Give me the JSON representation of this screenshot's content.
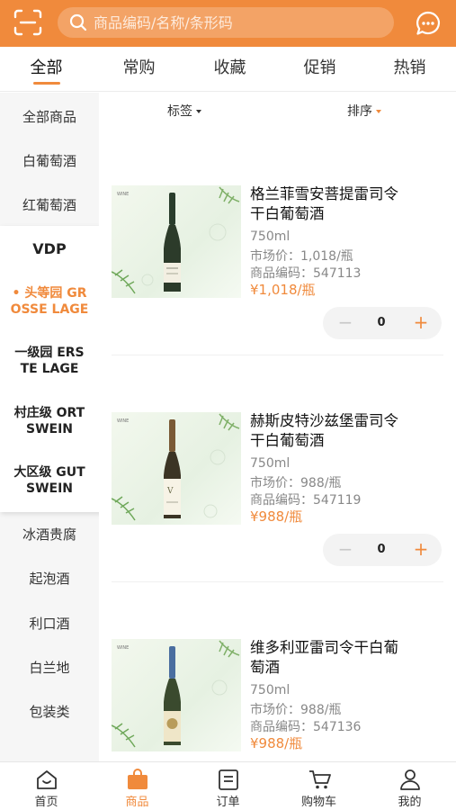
{
  "search": {
    "placeholder": "商品编码/名称/条形码"
  },
  "tabs": [
    {
      "label": "全部"
    },
    {
      "label": "常购"
    },
    {
      "label": "收藏"
    },
    {
      "label": "促销"
    },
    {
      "label": "热销"
    }
  ],
  "sidebar": {
    "top_items": [
      {
        "label": "全部商品"
      },
      {
        "label": "白葡萄酒"
      },
      {
        "label": "红葡萄酒"
      }
    ],
    "sub_panel": {
      "title": "VDP",
      "items": [
        {
          "label": "• 头等园 GROSSE LAGE",
          "line1": "• 头等园 GR",
          "line2": "OSSE LAGE",
          "selected": true
        },
        {
          "label": "一级园 ERSTE LAGE",
          "line1": "一级园 ERS",
          "line2": "TE LAGE",
          "selected": false
        },
        {
          "label": "村庄级 ORTSWEIN",
          "line1": "村庄级 ORT",
          "line2": "SWEIN",
          "selected": false
        },
        {
          "label": "大区级 GUTSWEIN",
          "line1": "大区级 GUT",
          "line2": "SWEIN",
          "selected": false
        }
      ]
    },
    "bottom_items": [
      {
        "label": "冰酒贵腐"
      },
      {
        "label": "起泡酒"
      },
      {
        "label": "利口酒"
      },
      {
        "label": "白兰地"
      },
      {
        "label": "包装类"
      }
    ]
  },
  "filter": {
    "tag_label": "标签",
    "sort_label": "排序"
  },
  "products": [
    {
      "name": "格兰菲雪安菩提雷司令干白葡萄酒",
      "name_line1": "格兰菲雪安菩提雷司令",
      "name_line2": "干白葡萄酒",
      "volume": "750ml",
      "market_price": "市场价：1,018/瓶",
      "code": "商品编码：547113",
      "price": "¥1,018/瓶",
      "qty": "0",
      "cap_color": "#2a3d2c"
    },
    {
      "name": "赫斯皮特沙兹堡雷司令干白葡萄酒",
      "name_line1": "赫斯皮特沙兹堡雷司令",
      "name_line2": "干白葡萄酒",
      "volume": "750ml",
      "market_price": "市场价：988/瓶",
      "code": "商品编码：547119",
      "price": "¥988/瓶",
      "qty": "0",
      "cap_color": "#7a5a36"
    },
    {
      "name": "维多利亚雷司令干白葡萄酒",
      "name_line1": "维多利亚雷司令干白葡",
      "name_line2": "萄酒",
      "volume": "750ml",
      "market_price": "市场价：988/瓶",
      "code": "商品编码：547136",
      "price": "¥988/瓶",
      "qty": "0",
      "cap_color": "#4a6ea0"
    }
  ],
  "bottom_nav": [
    {
      "label": "首页",
      "icon": "home-icon",
      "active": false
    },
    {
      "label": "商品",
      "icon": "bag-icon",
      "active": true
    },
    {
      "label": "订单",
      "icon": "order-icon",
      "active": false
    },
    {
      "label": "购物车",
      "icon": "cart-icon",
      "active": false
    },
    {
      "label": "我的",
      "icon": "user-icon",
      "active": false
    }
  ],
  "colors": {
    "accent": "#f08a3c",
    "sidebar_bg": "#f6f6f6"
  }
}
